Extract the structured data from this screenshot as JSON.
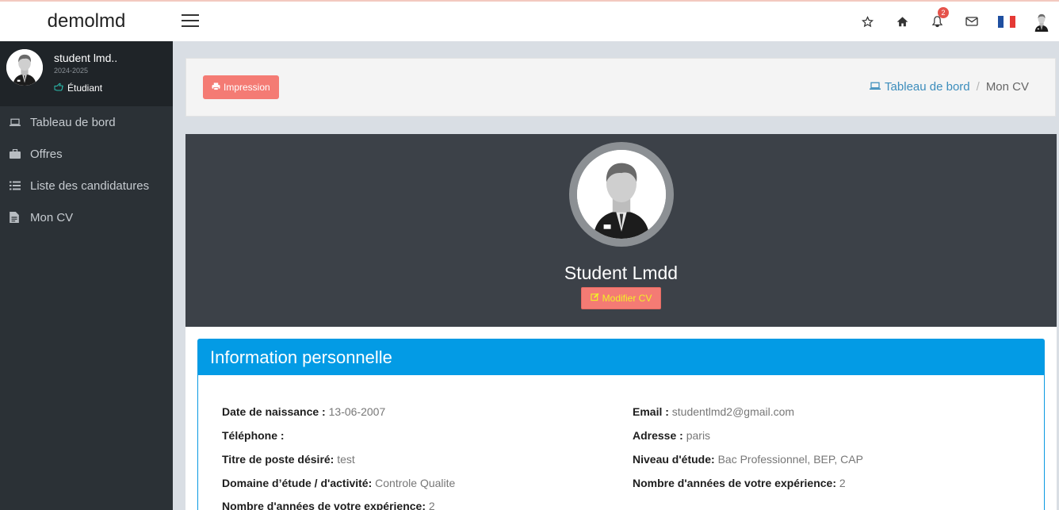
{
  "app": {
    "brand": "demolmd"
  },
  "topbar": {
    "notifications_count": "2",
    "icons": [
      "star-icon",
      "home-icon",
      "bell-icon",
      "envelope-icon",
      "flag-fr-icon",
      "user-avatar-icon"
    ],
    "flag_colors": [
      "#1f4fa0",
      "#ffffff",
      "#e53935"
    ]
  },
  "user": {
    "name": "student lmd..",
    "year": "2024-2025",
    "role": "Étudiant"
  },
  "sidebar": {
    "items": [
      {
        "label": "Tableau de bord",
        "icon": "laptop-icon"
      },
      {
        "label": "Offres",
        "icon": "briefcase-icon"
      },
      {
        "label": "Liste des candidatures",
        "icon": "list-icon"
      },
      {
        "label": "Mon CV",
        "icon": "file-icon"
      }
    ]
  },
  "header": {
    "print_label": "Impression",
    "breadcrumb_home": "Tableau de bord",
    "breadcrumb_separator": "/",
    "breadcrumb_current": "Mon CV"
  },
  "profile": {
    "name": "Student Lmdd",
    "modify_label": "Modifier CV"
  },
  "info": {
    "title": "Information personnelle",
    "left": [
      {
        "label": "Date de naissance : ",
        "value": "13-06-2007"
      },
      {
        "label": "Téléphone : ",
        "value": ""
      },
      {
        "label": "Titre de poste désiré: ",
        "value": "test"
      },
      {
        "label": "Domaine d’étude / d'activité: ",
        "value": "Controle Qualite"
      },
      {
        "label": "Nombre d'années de votre expérience: ",
        "value": "2"
      }
    ],
    "right": [
      {
        "label": "Email : ",
        "value": "studentlmd2@gmail.com"
      },
      {
        "label": "Adresse : ",
        "value": "paris"
      },
      {
        "label": "Niveau d'étude: ",
        "value": "Bac Professionnel, BEP, CAP"
      },
      {
        "label": "Nombre d'années de votre expérience: ",
        "value": "2"
      }
    ]
  },
  "colors": {
    "sidebar_bg": "#2b3136",
    "profile_bg": "#3c4148",
    "card_header": "#039be5",
    "button_red": "#f47b74",
    "link_blue": "#3c8dbc"
  }
}
